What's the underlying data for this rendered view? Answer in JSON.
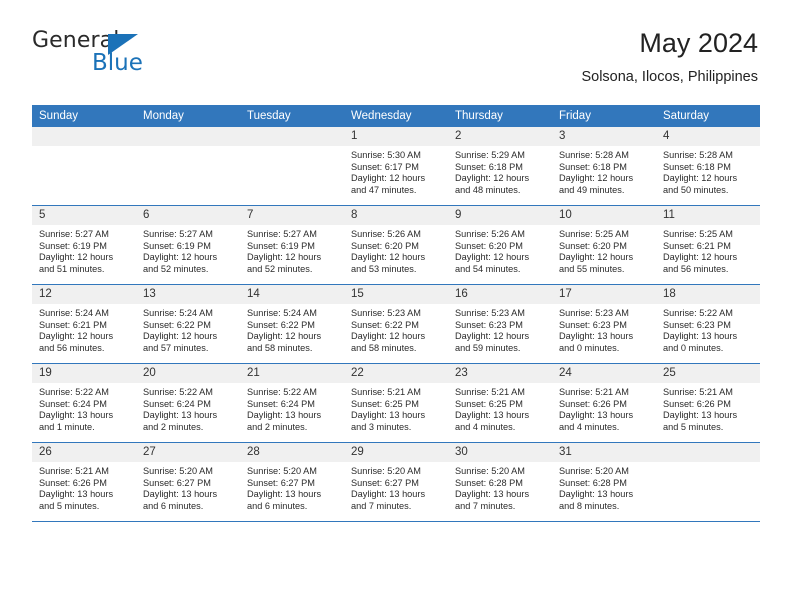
{
  "logo": {
    "word_general": "General",
    "word_blue": "Blue",
    "triangle_color": "#1b72b8"
  },
  "header": {
    "title": "May 2024",
    "subtitle": "Solsona, Ilocos, Philippines"
  },
  "theme": {
    "header_blue": "#3277bc",
    "daynum_band": "#f0f0f0",
    "text": "#2b2b2b"
  },
  "weekday_headers": [
    "Sunday",
    "Monday",
    "Tuesday",
    "Wednesday",
    "Thursday",
    "Friday",
    "Saturday"
  ],
  "weeks": [
    [
      {
        "day": "",
        "empty": true,
        "sunrise": "",
        "sunset": "",
        "daylight1": "",
        "daylight2": ""
      },
      {
        "day": "",
        "empty": true,
        "sunrise": "",
        "sunset": "",
        "daylight1": "",
        "daylight2": ""
      },
      {
        "day": "",
        "empty": true,
        "sunrise": "",
        "sunset": "",
        "daylight1": "",
        "daylight2": ""
      },
      {
        "day": "1",
        "empty": false,
        "sunrise": "Sunrise: 5:30 AM",
        "sunset": "Sunset: 6:17 PM",
        "daylight1": "Daylight: 12 hours",
        "daylight2": "and 47 minutes."
      },
      {
        "day": "2",
        "empty": false,
        "sunrise": "Sunrise: 5:29 AM",
        "sunset": "Sunset: 6:18 PM",
        "daylight1": "Daylight: 12 hours",
        "daylight2": "and 48 minutes."
      },
      {
        "day": "3",
        "empty": false,
        "sunrise": "Sunrise: 5:28 AM",
        "sunset": "Sunset: 6:18 PM",
        "daylight1": "Daylight: 12 hours",
        "daylight2": "and 49 minutes."
      },
      {
        "day": "4",
        "empty": false,
        "sunrise": "Sunrise: 5:28 AM",
        "sunset": "Sunset: 6:18 PM",
        "daylight1": "Daylight: 12 hours",
        "daylight2": "and 50 minutes."
      }
    ],
    [
      {
        "day": "5",
        "empty": false,
        "sunrise": "Sunrise: 5:27 AM",
        "sunset": "Sunset: 6:19 PM",
        "daylight1": "Daylight: 12 hours",
        "daylight2": "and 51 minutes."
      },
      {
        "day": "6",
        "empty": false,
        "sunrise": "Sunrise: 5:27 AM",
        "sunset": "Sunset: 6:19 PM",
        "daylight1": "Daylight: 12 hours",
        "daylight2": "and 52 minutes."
      },
      {
        "day": "7",
        "empty": false,
        "sunrise": "Sunrise: 5:27 AM",
        "sunset": "Sunset: 6:19 PM",
        "daylight1": "Daylight: 12 hours",
        "daylight2": "and 52 minutes."
      },
      {
        "day": "8",
        "empty": false,
        "sunrise": "Sunrise: 5:26 AM",
        "sunset": "Sunset: 6:20 PM",
        "daylight1": "Daylight: 12 hours",
        "daylight2": "and 53 minutes."
      },
      {
        "day": "9",
        "empty": false,
        "sunrise": "Sunrise: 5:26 AM",
        "sunset": "Sunset: 6:20 PM",
        "daylight1": "Daylight: 12 hours",
        "daylight2": "and 54 minutes."
      },
      {
        "day": "10",
        "empty": false,
        "sunrise": "Sunrise: 5:25 AM",
        "sunset": "Sunset: 6:20 PM",
        "daylight1": "Daylight: 12 hours",
        "daylight2": "and 55 minutes."
      },
      {
        "day": "11",
        "empty": false,
        "sunrise": "Sunrise: 5:25 AM",
        "sunset": "Sunset: 6:21 PM",
        "daylight1": "Daylight: 12 hours",
        "daylight2": "and 56 minutes."
      }
    ],
    [
      {
        "day": "12",
        "empty": false,
        "sunrise": "Sunrise: 5:24 AM",
        "sunset": "Sunset: 6:21 PM",
        "daylight1": "Daylight: 12 hours",
        "daylight2": "and 56 minutes."
      },
      {
        "day": "13",
        "empty": false,
        "sunrise": "Sunrise: 5:24 AM",
        "sunset": "Sunset: 6:22 PM",
        "daylight1": "Daylight: 12 hours",
        "daylight2": "and 57 minutes."
      },
      {
        "day": "14",
        "empty": false,
        "sunrise": "Sunrise: 5:24 AM",
        "sunset": "Sunset: 6:22 PM",
        "daylight1": "Daylight: 12 hours",
        "daylight2": "and 58 minutes."
      },
      {
        "day": "15",
        "empty": false,
        "sunrise": "Sunrise: 5:23 AM",
        "sunset": "Sunset: 6:22 PM",
        "daylight1": "Daylight: 12 hours",
        "daylight2": "and 58 minutes."
      },
      {
        "day": "16",
        "empty": false,
        "sunrise": "Sunrise: 5:23 AM",
        "sunset": "Sunset: 6:23 PM",
        "daylight1": "Daylight: 12 hours",
        "daylight2": "and 59 minutes."
      },
      {
        "day": "17",
        "empty": false,
        "sunrise": "Sunrise: 5:23 AM",
        "sunset": "Sunset: 6:23 PM",
        "daylight1": "Daylight: 13 hours",
        "daylight2": "and 0 minutes."
      },
      {
        "day": "18",
        "empty": false,
        "sunrise": "Sunrise: 5:22 AM",
        "sunset": "Sunset: 6:23 PM",
        "daylight1": "Daylight: 13 hours",
        "daylight2": "and 0 minutes."
      }
    ],
    [
      {
        "day": "19",
        "empty": false,
        "sunrise": "Sunrise: 5:22 AM",
        "sunset": "Sunset: 6:24 PM",
        "daylight1": "Daylight: 13 hours",
        "daylight2": "and 1 minute."
      },
      {
        "day": "20",
        "empty": false,
        "sunrise": "Sunrise: 5:22 AM",
        "sunset": "Sunset: 6:24 PM",
        "daylight1": "Daylight: 13 hours",
        "daylight2": "and 2 minutes."
      },
      {
        "day": "21",
        "empty": false,
        "sunrise": "Sunrise: 5:22 AM",
        "sunset": "Sunset: 6:24 PM",
        "daylight1": "Daylight: 13 hours",
        "daylight2": "and 2 minutes."
      },
      {
        "day": "22",
        "empty": false,
        "sunrise": "Sunrise: 5:21 AM",
        "sunset": "Sunset: 6:25 PM",
        "daylight1": "Daylight: 13 hours",
        "daylight2": "and 3 minutes."
      },
      {
        "day": "23",
        "empty": false,
        "sunrise": "Sunrise: 5:21 AM",
        "sunset": "Sunset: 6:25 PM",
        "daylight1": "Daylight: 13 hours",
        "daylight2": "and 4 minutes."
      },
      {
        "day": "24",
        "empty": false,
        "sunrise": "Sunrise: 5:21 AM",
        "sunset": "Sunset: 6:26 PM",
        "daylight1": "Daylight: 13 hours",
        "daylight2": "and 4 minutes."
      },
      {
        "day": "25",
        "empty": false,
        "sunrise": "Sunrise: 5:21 AM",
        "sunset": "Sunset: 6:26 PM",
        "daylight1": "Daylight: 13 hours",
        "daylight2": "and 5 minutes."
      }
    ],
    [
      {
        "day": "26",
        "empty": false,
        "sunrise": "Sunrise: 5:21 AM",
        "sunset": "Sunset: 6:26 PM",
        "daylight1": "Daylight: 13 hours",
        "daylight2": "and 5 minutes."
      },
      {
        "day": "27",
        "empty": false,
        "sunrise": "Sunrise: 5:20 AM",
        "sunset": "Sunset: 6:27 PM",
        "daylight1": "Daylight: 13 hours",
        "daylight2": "and 6 minutes."
      },
      {
        "day": "28",
        "empty": false,
        "sunrise": "Sunrise: 5:20 AM",
        "sunset": "Sunset: 6:27 PM",
        "daylight1": "Daylight: 13 hours",
        "daylight2": "and 6 minutes."
      },
      {
        "day": "29",
        "empty": false,
        "sunrise": "Sunrise: 5:20 AM",
        "sunset": "Sunset: 6:27 PM",
        "daylight1": "Daylight: 13 hours",
        "daylight2": "and 7 minutes."
      },
      {
        "day": "30",
        "empty": false,
        "sunrise": "Sunrise: 5:20 AM",
        "sunset": "Sunset: 6:28 PM",
        "daylight1": "Daylight: 13 hours",
        "daylight2": "and 7 minutes."
      },
      {
        "day": "31",
        "empty": false,
        "sunrise": "Sunrise: 5:20 AM",
        "sunset": "Sunset: 6:28 PM",
        "daylight1": "Daylight: 13 hours",
        "daylight2": "and 8 minutes."
      },
      {
        "day": "",
        "empty": true,
        "sunrise": "",
        "sunset": "",
        "daylight1": "",
        "daylight2": ""
      }
    ]
  ]
}
